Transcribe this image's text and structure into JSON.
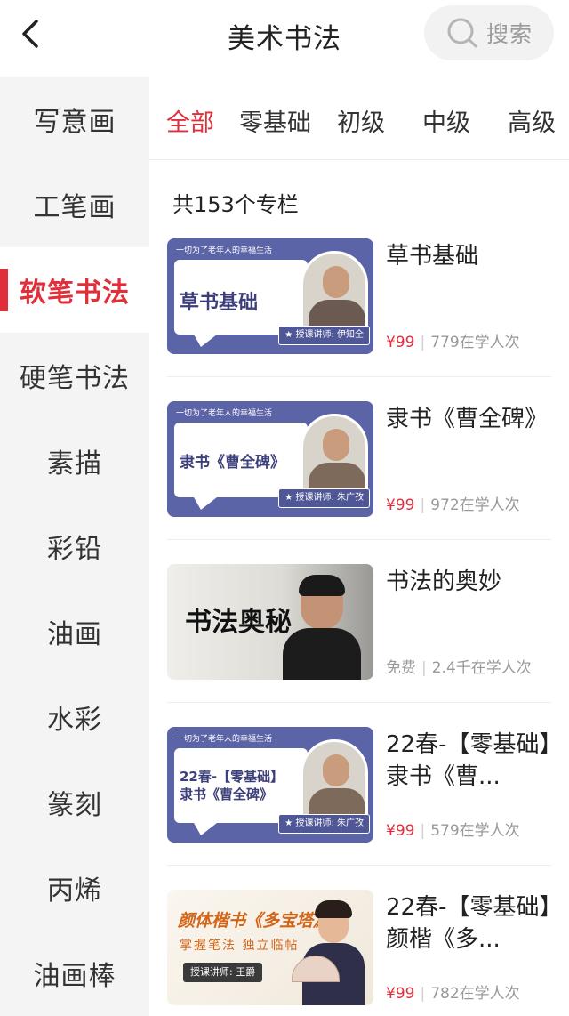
{
  "header": {
    "title": "美术书法",
    "search_label": "搜索"
  },
  "sidebar": {
    "items": [
      {
        "label": "写意画"
      },
      {
        "label": "工笔画"
      },
      {
        "label": "软笔书法",
        "active": true
      },
      {
        "label": "硬笔书法"
      },
      {
        "label": "素描"
      },
      {
        "label": "彩铅"
      },
      {
        "label": "油画"
      },
      {
        "label": "水彩"
      },
      {
        "label": "篆刻"
      },
      {
        "label": "丙烯"
      },
      {
        "label": "油画棒"
      }
    ]
  },
  "tabs": [
    {
      "label": "全部",
      "active": true
    },
    {
      "label": "零基础"
    },
    {
      "label": "初级"
    },
    {
      "label": "中级"
    },
    {
      "label": "高级"
    }
  ],
  "count_label": "共153个专栏",
  "courses": [
    {
      "title": "草书基础",
      "price": "¥99",
      "learners": "779在学人次",
      "thumb": {
        "slogan": "一切为了老年人的幸福生活",
        "heading": "草书基础",
        "teacher": "★ 授课讲师: 伊知全"
      }
    },
    {
      "title": "隶书《曹全碑》",
      "price": "¥99",
      "learners": "972在学人次",
      "thumb": {
        "slogan": "一切为了老年人的幸福生活",
        "heading": "隶书《曹全碑》",
        "teacher": "★ 授课讲师: 朱广孜"
      }
    },
    {
      "title": "书法的奥妙",
      "price": "免费",
      "learners": "2.4千在学人次",
      "thumb": {
        "heading": "书法奥秘"
      }
    },
    {
      "title": "22春-【零基础】隶书《曹...",
      "price": "¥99",
      "learners": "579在学人次",
      "thumb": {
        "slogan": "一切为了老年人的幸福生活",
        "heading_line1": "22春-【零基础】",
        "heading_line2": "隶书《曹全碑》",
        "teacher": "★ 授课讲师: 朱广孜"
      }
    },
    {
      "title": "22春-【零基础】颜楷《多...",
      "price": "¥99",
      "learners": "782在学人次",
      "thumb": {
        "heading": "颜体楷书《多宝塔》",
        "sub": "掌握笔法 独立临帖",
        "teacher": "授课讲师: 王爵"
      }
    }
  ],
  "colors": {
    "accent": "#e02e3a",
    "sidebar_bg": "#f4f4f4",
    "thumb_blue": "#5c64a8"
  }
}
